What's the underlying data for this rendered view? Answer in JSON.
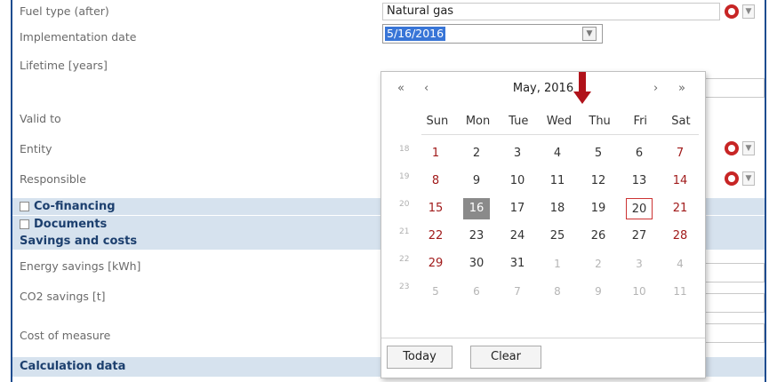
{
  "form": {
    "fuel_type_label": "Fuel type (after)",
    "fuel_type_value": "Natural gas",
    "implementation_date_label": "Implementation date",
    "implementation_date_value": "5/16/2016",
    "lifetime_label": "Lifetime [years]",
    "valid_to_label": "Valid to",
    "entity_label": "Entity",
    "responsible_label": "Responsible",
    "cofinancing_label": "Co-financing",
    "documents_label": "Documents",
    "savings_section": "Savings and costs",
    "energy_savings_label": "Energy savings [kWh]",
    "co2_savings_label": "CO2 savings [t]",
    "cost_label": "Cost of measure",
    "calc_section": "Calculation data"
  },
  "calendar": {
    "nav_prev_year": "«",
    "nav_prev_month": "‹",
    "month_title": "May, 2016",
    "nav_next_month": "›",
    "nav_next_year": "»",
    "weekdays": [
      "Sun",
      "Mon",
      "Tue",
      "Wed",
      "Thu",
      "Fri",
      "Sat"
    ],
    "weeks": [
      {
        "num": "18",
        "days": [
          "1",
          "2",
          "3",
          "4",
          "5",
          "6",
          "7"
        ]
      },
      {
        "num": "19",
        "days": [
          "8",
          "9",
          "10",
          "11",
          "12",
          "13",
          "14"
        ]
      },
      {
        "num": "20",
        "days": [
          "15",
          "16",
          "17",
          "18",
          "19",
          "20",
          "21"
        ]
      },
      {
        "num": "21",
        "days": [
          "22",
          "23",
          "24",
          "25",
          "26",
          "27",
          "28"
        ]
      },
      {
        "num": "22",
        "days": [
          "29",
          "30",
          "31",
          "1",
          "2",
          "3",
          "4"
        ]
      },
      {
        "num": "23",
        "days": [
          "5",
          "6",
          "7",
          "8",
          "9",
          "10",
          "11"
        ]
      }
    ],
    "selected_day": "16",
    "today_day": "20",
    "today_button": "Today",
    "clear_button": "Clear"
  },
  "colors": {
    "frame_border": "#1e4c8f",
    "section_bg": "#d6e2ee",
    "selection_blue": "#3875d7",
    "weekend_red": "#a11b1b",
    "annotation_arrow": "#b0121a"
  },
  "icons": {
    "clear": "clear-circle-icon",
    "dropdown": "chevron-down-icon"
  }
}
